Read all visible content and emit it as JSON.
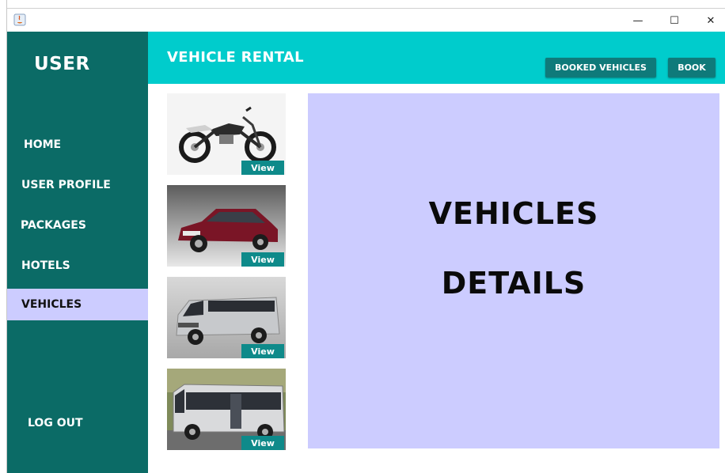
{
  "window": {
    "controls": {
      "minimize": "—",
      "maximize": "☐",
      "close": "✕"
    }
  },
  "sidebar": {
    "title": "USER",
    "items": [
      {
        "label": "HOME",
        "active": false
      },
      {
        "label": "USER PROFILE",
        "active": false
      },
      {
        "label": "PACKAGES",
        "active": false
      },
      {
        "label": "HOTELS",
        "active": false
      },
      {
        "label": "VEHICLES",
        "active": true
      }
    ],
    "logout_label": "LOG OUT"
  },
  "header": {
    "title": "VEHICLE RENTAL",
    "booked_label": "BOOKED VEHICLES",
    "book_label": "BOOK"
  },
  "vehicles": [
    {
      "name": "motorcycle",
      "view_label": "View"
    },
    {
      "name": "car",
      "view_label": "View"
    },
    {
      "name": "van",
      "view_label": "View"
    },
    {
      "name": "bus",
      "view_label": "View"
    }
  ],
  "details": {
    "line1": "VEHICLES",
    "line2": "DETAILS"
  },
  "colors": {
    "sidebar": "#0b6b66",
    "header": "#00cccc",
    "active_item": "#ccccff",
    "details_panel": "#ccccff",
    "button": "#0f7a7a"
  }
}
